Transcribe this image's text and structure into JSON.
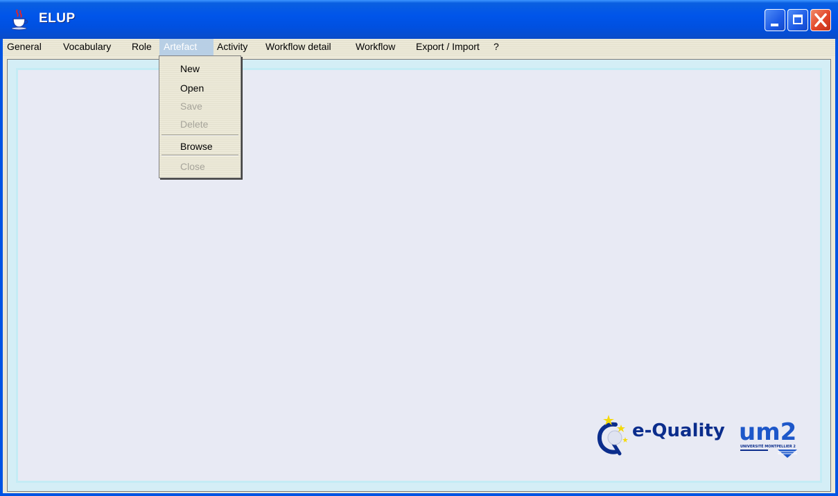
{
  "window": {
    "title": "ELUP",
    "buttons": [
      "minimize",
      "maximize",
      "close"
    ]
  },
  "menubar": {
    "items": [
      {
        "label": "General"
      },
      {
        "label": "Vocabulary"
      },
      {
        "label": "Role"
      },
      {
        "label": "Artefact",
        "active": true
      },
      {
        "label": "Activity"
      },
      {
        "label": "Workflow detail"
      },
      {
        "label": "Workflow"
      },
      {
        "label": "Export / Import"
      },
      {
        "label": "?"
      }
    ]
  },
  "artefact_menu": {
    "items": [
      {
        "label": "New",
        "enabled": true
      },
      {
        "label": "Open",
        "enabled": true
      },
      {
        "label": "Save",
        "enabled": false
      },
      {
        "label": "Delete",
        "enabled": false
      },
      {
        "label": "Browse",
        "enabled": true
      },
      {
        "label": "Close",
        "enabled": false
      }
    ]
  },
  "branding": {
    "eq_logo_text": "e-Quality",
    "um2_logo_text": "um2",
    "um2_subtitle": "UNIVERSITÉ MONTPELLIER 2"
  },
  "colors": {
    "titlebar": "#0055ea",
    "menu_highlight": "#b8cfe5",
    "panel_background": "#e8eaf4",
    "panel_border": "#c4ecf5",
    "logo_blue": "#0b2d8c"
  }
}
